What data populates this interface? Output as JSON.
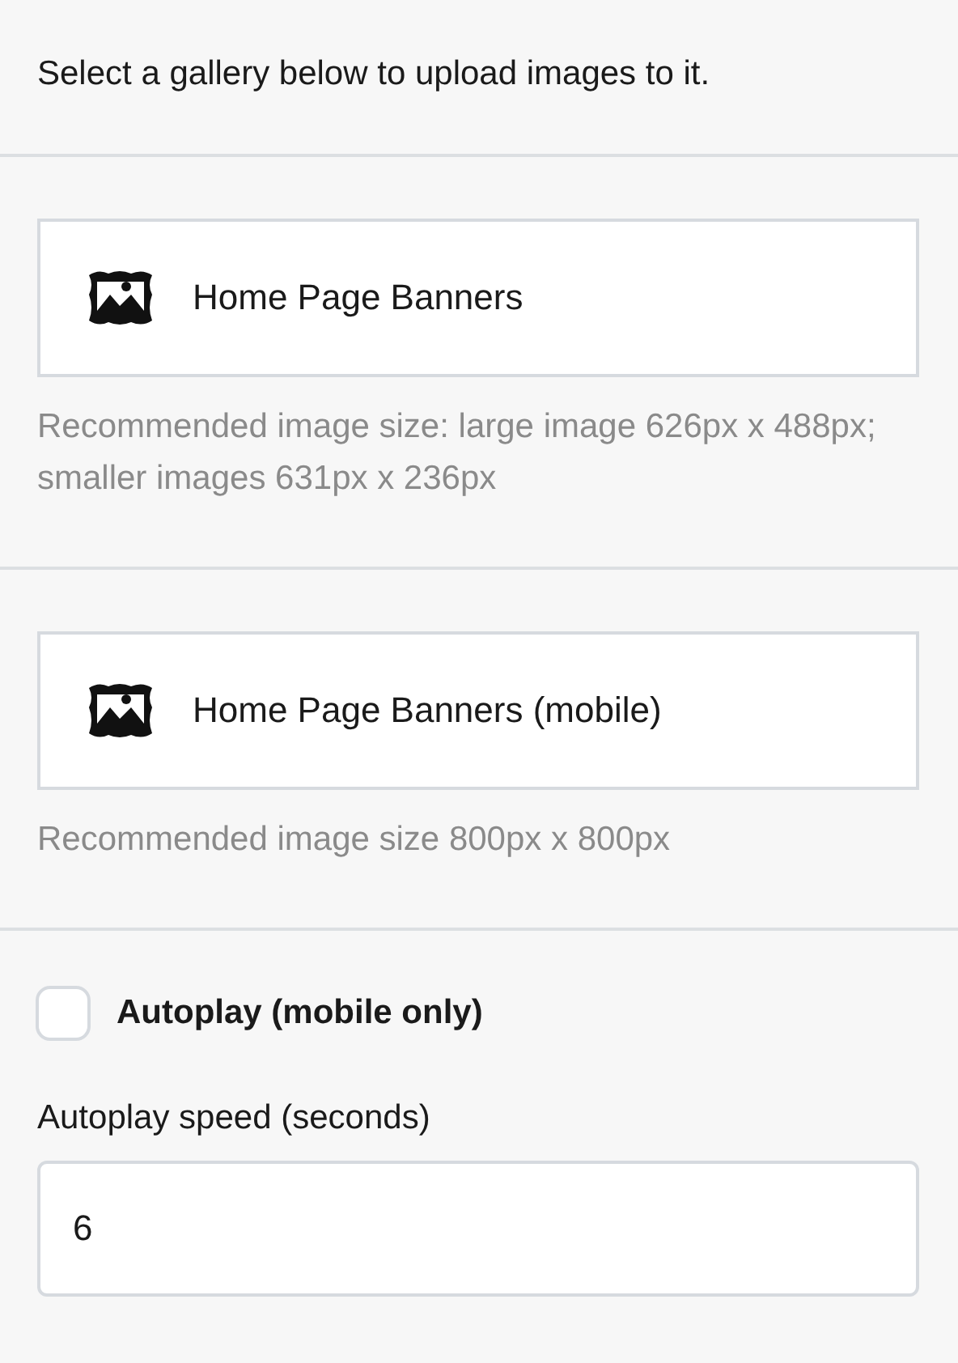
{
  "intro": "Select a gallery below to upload images to it.",
  "galleries": [
    {
      "name": "Home Page Banners",
      "hint": "Recommended image size: large image 626px x 488px; smaller images 631px x 236px"
    },
    {
      "name": "Home Page Banners (mobile)",
      "hint": "Recommended image size 800px x 800px"
    }
  ],
  "autoplay": {
    "label": "Autoplay (mobile only)",
    "checked": false
  },
  "speed": {
    "label": "Autoplay speed (seconds)",
    "value": "6"
  }
}
